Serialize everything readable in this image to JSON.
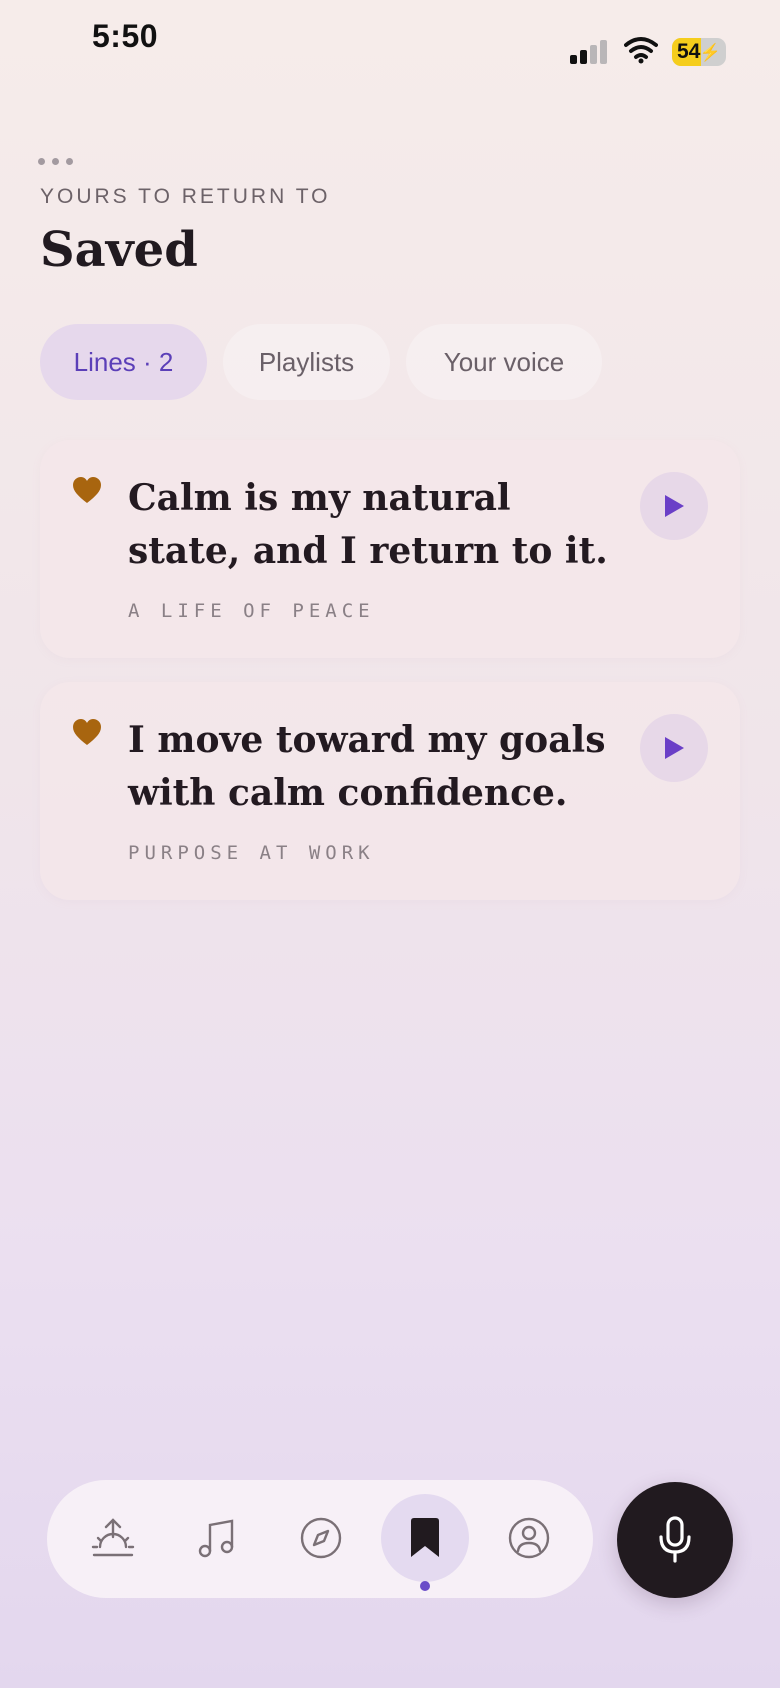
{
  "status_bar": {
    "time": "5:50",
    "battery_level": 54,
    "battery_text": "54",
    "battery_color": "#f5cd1c",
    "icons": [
      "signal-icon",
      "wifi-icon",
      "battery-icon",
      "charging-bolt-icon"
    ]
  },
  "header": {
    "menu_icon": "more-dots-icon",
    "eyebrow": "YOURS TO RETURN TO",
    "title": "Saved"
  },
  "tabs": [
    {
      "label": "Lines · 2",
      "active": true
    },
    {
      "label": "Playlists",
      "active": false
    },
    {
      "label": "Your voice",
      "active": false
    }
  ],
  "cards": [
    {
      "icon": "heart-icon",
      "quote": "Calm is my natural state, and I return to it.",
      "source": "A LIFE OF PEACE",
      "action_icon": "play-icon"
    },
    {
      "icon": "heart-icon",
      "quote": "I move toward my goals with calm confidence.",
      "source": "PURPOSE AT WORK",
      "action_icon": "play-icon"
    }
  ],
  "bottom_nav": {
    "items": [
      {
        "icon": "sunrise-icon",
        "active": false
      },
      {
        "icon": "music-note-icon",
        "active": false
      },
      {
        "icon": "compass-icon",
        "active": false
      },
      {
        "icon": "bookmark-icon",
        "active": true
      },
      {
        "icon": "profile-icon",
        "active": false
      }
    ],
    "mic_icon": "microphone-icon"
  },
  "colors": {
    "accent": "#5b3fb8",
    "heart": "#a8650f",
    "play": "#6a3fc7",
    "dark": "#211a1f"
  }
}
